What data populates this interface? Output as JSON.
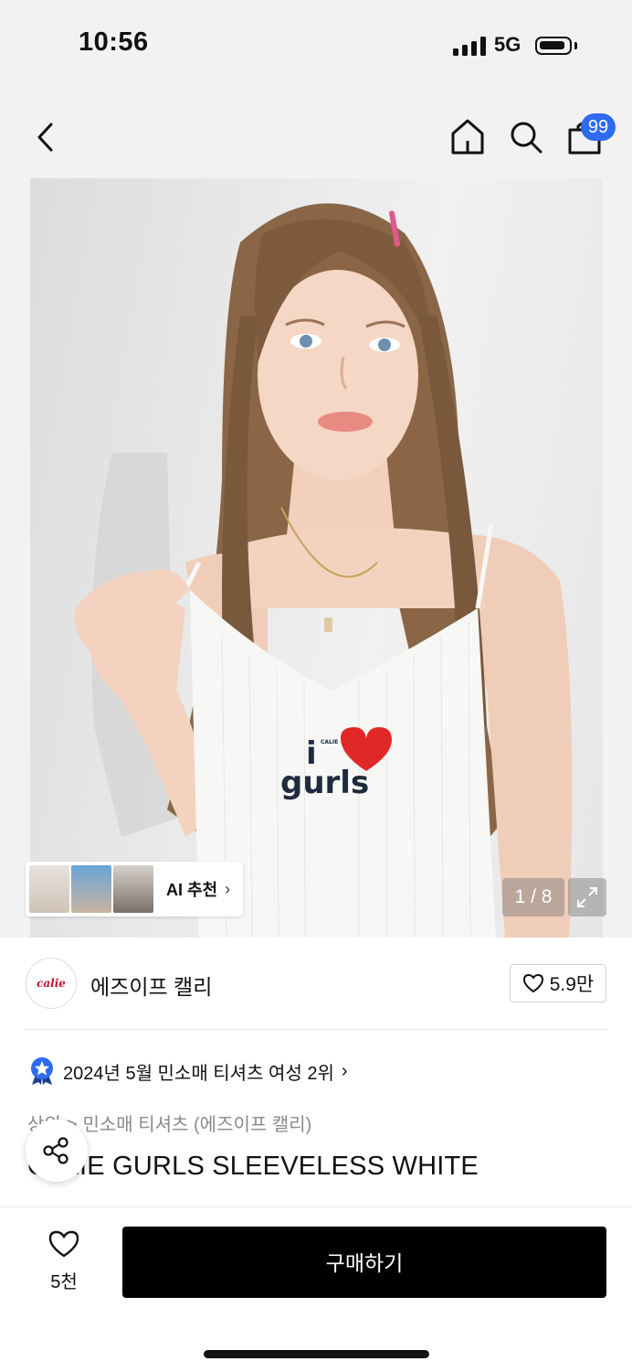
{
  "status": {
    "time": "10:56",
    "network": "5G"
  },
  "nav": {
    "cart_count": "99",
    "icons": [
      "back-icon",
      "home-icon",
      "search-icon",
      "cart-icon"
    ]
  },
  "gallery": {
    "counter": "1 / 8",
    "ai_label": "AI 추천",
    "tshirt_text_top": "i",
    "tshirt_text_bottom": "gurls",
    "heart_text": "CALIE"
  },
  "brand": {
    "logo_text": "calie",
    "name": "에즈이프 캘리",
    "like_count": "5.9만"
  },
  "ranking": {
    "text": "2024년 5월 민소매 티셔츠 여성 2위"
  },
  "breadcrumb": {
    "category": "상의",
    "separator": ">",
    "subcategory": "민소매 티셔츠 (에즈이프 캘리)"
  },
  "product": {
    "title": "CALIE GURLS SLEEVELESS WHITE"
  },
  "bottom_bar": {
    "wish_count": "5천",
    "buy_label": "구매하기"
  },
  "colors": {
    "accent_badge": "#2e6bf0",
    "buy_button": "#000000",
    "brand_red": "#c8102e"
  }
}
